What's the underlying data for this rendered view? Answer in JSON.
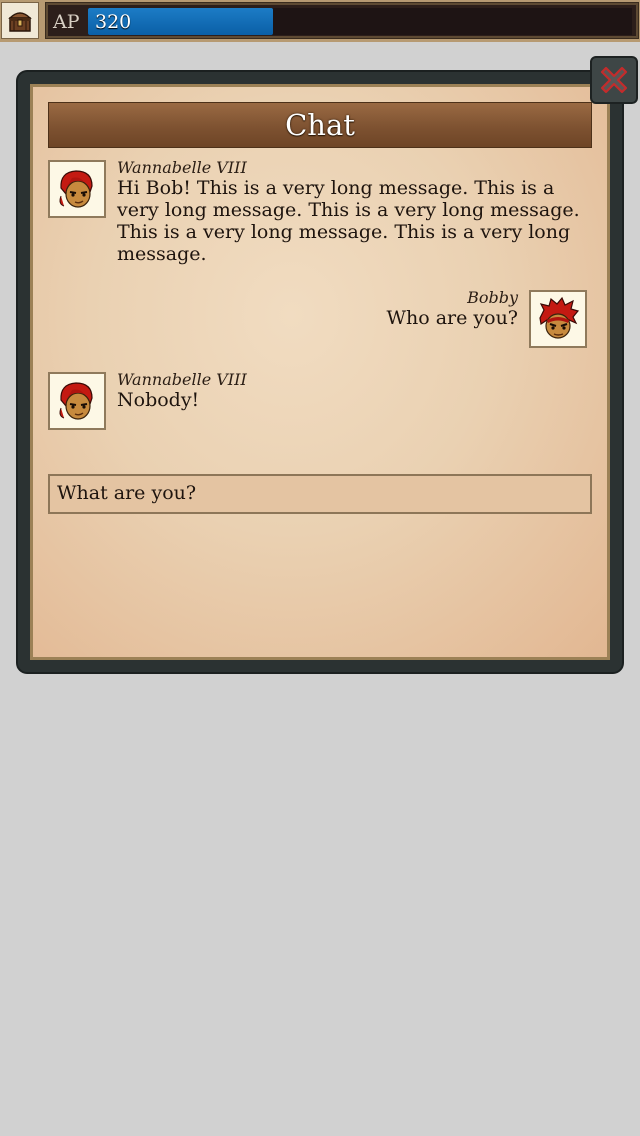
{
  "topbar": {
    "chest_icon": "treasure-chest-icon",
    "ap_label": "AP",
    "ap_value": "320",
    "ap_fill_percent": 34,
    "ap_bar_color": "#0f6bb4"
  },
  "dialog": {
    "title": "Chat",
    "close_icon": "close-icon"
  },
  "messages": [
    {
      "sender": "Wannabelle VIII",
      "text": "Hi Bob! This is a very long message. This is a very long message. This is a very long message. This is a very long message. This is a very long message.",
      "lines": [
        "Hi Bob! This is a very long message. This is a",
        "very long message. This is a very long message.",
        "This is a very long message. This is a very long",
        "message."
      ],
      "side": "left",
      "avatar": "red-haired-character-avatar"
    },
    {
      "sender": "Bobby",
      "text": "Who are you?",
      "side": "right",
      "avatar": "spiky-red-haired-character-avatar"
    },
    {
      "sender": "Wannabelle VIII",
      "text": "Nobody!",
      "side": "left",
      "avatar": "red-haired-character-avatar"
    }
  ],
  "input": {
    "value": "What are you?"
  },
  "colors": {
    "background": "#d1d1d1",
    "parchment": "#ead1b2",
    "title_bar": "#7e5231",
    "frame": "#2b3232"
  }
}
